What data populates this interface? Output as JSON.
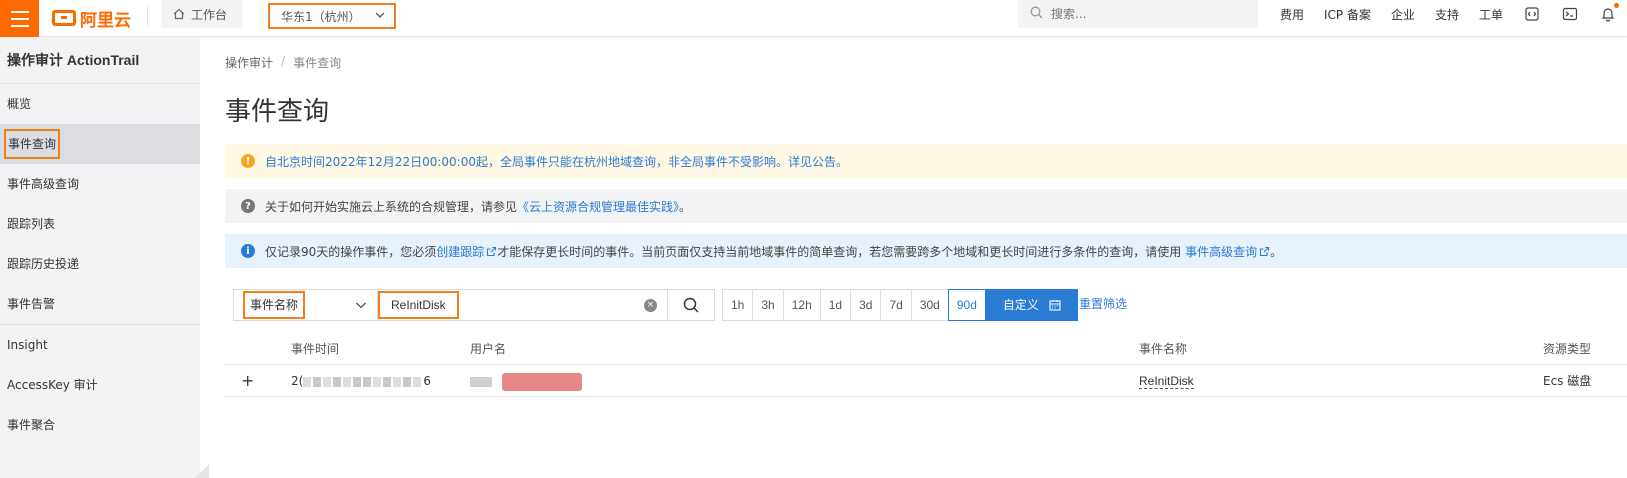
{
  "topbar": {
    "logo_text": "阿里云",
    "workbench_label": "工作台",
    "region_label": "华东1（杭州）",
    "search_placeholder": "搜索...",
    "links": [
      "费用",
      "ICP 备案",
      "企业",
      "支持",
      "工单"
    ],
    "accent_color": "#ff6a00"
  },
  "sidebar": {
    "title": "操作审计 ActionTrail",
    "items": [
      {
        "label": "概览"
      },
      {
        "label": "事件查询",
        "active": true
      },
      {
        "label": "事件高级查询"
      },
      {
        "label": "跟踪列表"
      },
      {
        "label": "跟踪历史投递"
      },
      {
        "label": "事件告警"
      },
      {
        "label": "Insight"
      },
      {
        "label": "AccessKey 审计"
      },
      {
        "label": "事件聚合"
      }
    ]
  },
  "breadcrumb": {
    "root": "操作审计",
    "current": "事件查询"
  },
  "page_title": "事件查询",
  "alerts": {
    "warning": "自北京时间2022年12月22日00:00:00起，全局事件只能在杭州地域查询，非全局事件不受影响。详见公告。",
    "help_prefix": "关于如何开始实施云上系统的合规管理，请参见",
    "help_link": "《云上资源合规管理最佳实践》",
    "help_suffix": "。",
    "info_prefix": "仅记录90天的操作事件，您必须",
    "info_link1": "创建跟踪",
    "info_middle": "才能保存更长时间的事件。当前页面仅支持当前地域事件的简单查询，若您需要跨多个地域和更长时间进行多条件的查询，请使用",
    "info_link2": "事件高级查询",
    "info_suffix": "。"
  },
  "search": {
    "field_label": "事件名称",
    "query_value": "ReInitDisk",
    "time_ranges": [
      "1h",
      "3h",
      "12h",
      "1d",
      "3d",
      "7d",
      "30d",
      "90d"
    ],
    "selected_range": "90d",
    "custom_label": "自定义",
    "reset_label": "重置筛选"
  },
  "table": {
    "headers": {
      "time": "事件时间",
      "user": "用户名",
      "event": "事件名称",
      "resource": "资源类型"
    },
    "rows": [
      {
        "expand": "+",
        "time_visible_start": "2(",
        "time_visible_end": "6",
        "event": "ReInitDisk",
        "resource": "Ecs 磁盘"
      }
    ]
  }
}
